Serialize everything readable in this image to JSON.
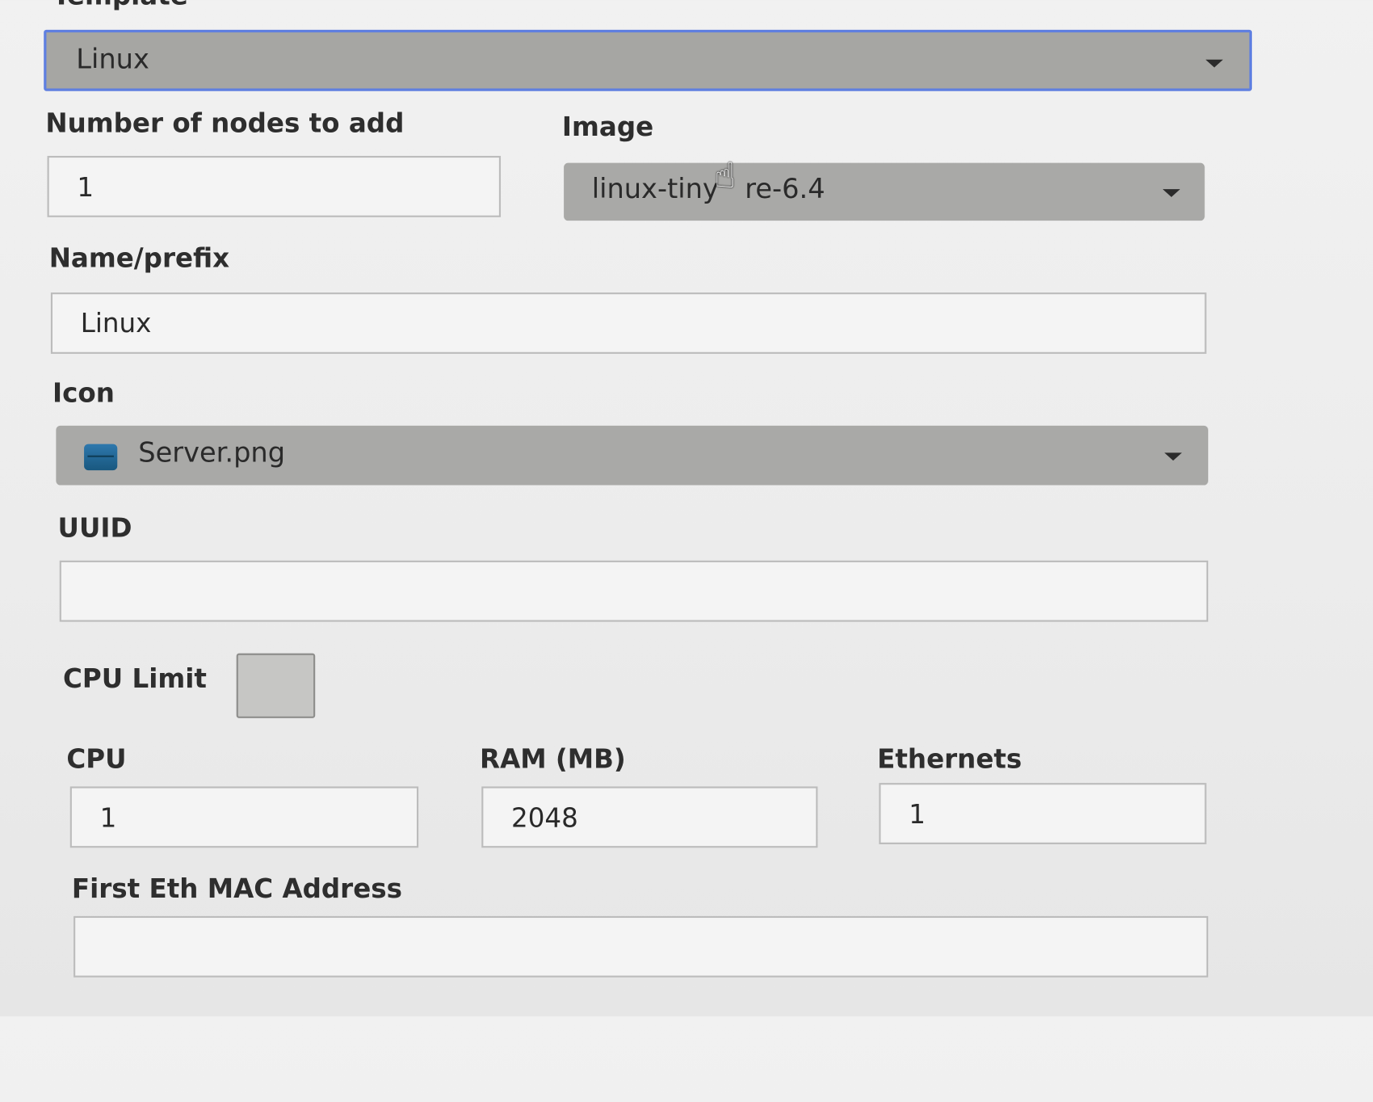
{
  "template": {
    "label": "Template",
    "value": "Linux"
  },
  "nodes": {
    "label": "Number of nodes to add",
    "value": "1"
  },
  "image": {
    "label": "Image",
    "value_left": "linux-tiny",
    "value_right": "re-6.4"
  },
  "name_prefix": {
    "label": "Name/prefix",
    "value": "Linux"
  },
  "icon": {
    "label": "Icon",
    "value": "Server.png",
    "icon_name": "server-icon"
  },
  "uuid": {
    "label": "UUID",
    "value": ""
  },
  "cpu_limit": {
    "label": "CPU Limit",
    "checked": false
  },
  "cpu": {
    "label": "CPU",
    "value": "1"
  },
  "ram": {
    "label": "RAM (MB)",
    "value": "2048"
  },
  "ethernets": {
    "label": "Ethernets",
    "value": "1"
  },
  "first_mac": {
    "label": "First Eth MAC Address",
    "value": ""
  },
  "colors": {
    "select_bg": "#a9a9a7",
    "focus_border": "#5f7fe0",
    "input_border": "#bcbcbc",
    "icon_blue": "#2e78ad"
  }
}
